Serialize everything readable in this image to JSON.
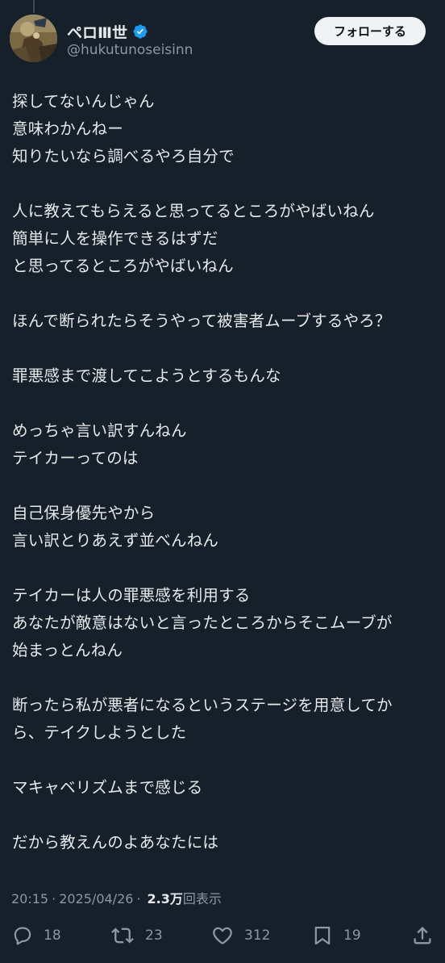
{
  "author": {
    "display_name": "ペロⅢ世",
    "handle": "@hukutunoseisinn",
    "verified": true
  },
  "follow_button": {
    "label": "フォローする"
  },
  "tweet": {
    "lines": [
      "探してないんじゃん",
      "意味わかんねー",
      "知りたいなら調べるやろ自分で",
      "",
      "人に教えてもらえると思ってるところがやばいねん",
      "簡単に人を操作できるはずだ",
      "と思ってるところがやばいねん",
      "",
      "ほんで断られたらそうやって被害者ムーブするやろ？",
      "",
      "罪悪感まで渡してこようとするもんな",
      "",
      "めっちゃ言い訳すんねん",
      "テイカーってのは",
      "",
      "自己保身優先やから",
      "言い訳とりあえず並べんねん",
      "",
      "テイカーは人の罪悪感を利用する",
      "あなたが敵意はないと言ったところからそこムーブが",
      "始まっとんねん",
      "",
      "断ったら私が悪者になるというステージを用意してか",
      "ら、テイクしようとした",
      "",
      "マキャベリズムまで感じる",
      "",
      "だから教えんのよあなたには"
    ]
  },
  "meta": {
    "time": "20:15",
    "separator": "·",
    "date": "2025/04/26",
    "views_count": "2.3万",
    "views_label": "回表示"
  },
  "actions": {
    "reply": {
      "icon": "reply-icon",
      "count": "18"
    },
    "retweet": {
      "icon": "retweet-icon",
      "count": "23"
    },
    "like": {
      "icon": "heart-icon",
      "count": "312"
    },
    "bookmark": {
      "icon": "bookmark-icon",
      "count": "19"
    },
    "share": {
      "icon": "share-icon"
    }
  },
  "colors": {
    "background": "#15202b",
    "text_primary": "#e7e9ea",
    "text_secondary": "#8b98a5",
    "verified_blue": "#1d9bf0",
    "follow_button_bg": "#eff3f4"
  }
}
